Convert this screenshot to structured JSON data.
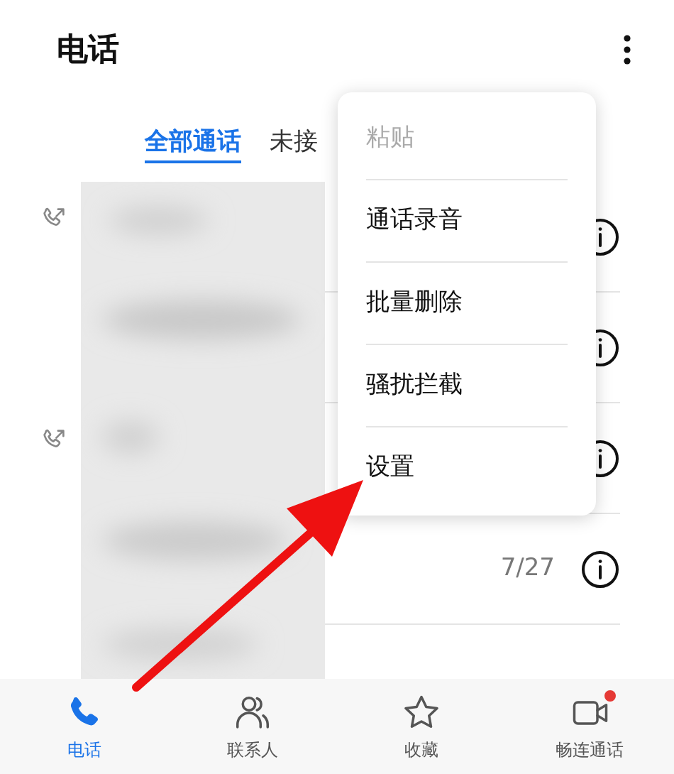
{
  "header": {
    "title": "电话"
  },
  "tabs": [
    {
      "label": "全部通话",
      "selected": true
    },
    {
      "label": "未接",
      "selected": false
    }
  ],
  "calls": [
    {
      "outgoing": true
    },
    {
      "outgoing": false
    },
    {
      "outgoing": true
    },
    {
      "outgoing": false,
      "date": "7/27"
    }
  ],
  "menu": [
    {
      "label": "粘贴",
      "disabled": true
    },
    {
      "label": "通话录音",
      "disabled": false
    },
    {
      "label": "批量删除",
      "disabled": false
    },
    {
      "label": "骚扰拦截",
      "disabled": false
    },
    {
      "label": "设置",
      "disabled": false
    }
  ],
  "bottom_nav": [
    {
      "kind": "phone",
      "label": "电话",
      "selected": true,
      "badge": false
    },
    {
      "kind": "contacts",
      "label": "联系人",
      "selected": false,
      "badge": false
    },
    {
      "kind": "star",
      "label": "收藏",
      "selected": false,
      "badge": false
    },
    {
      "kind": "video",
      "label": "畅连通话",
      "selected": false,
      "badge": true
    }
  ]
}
